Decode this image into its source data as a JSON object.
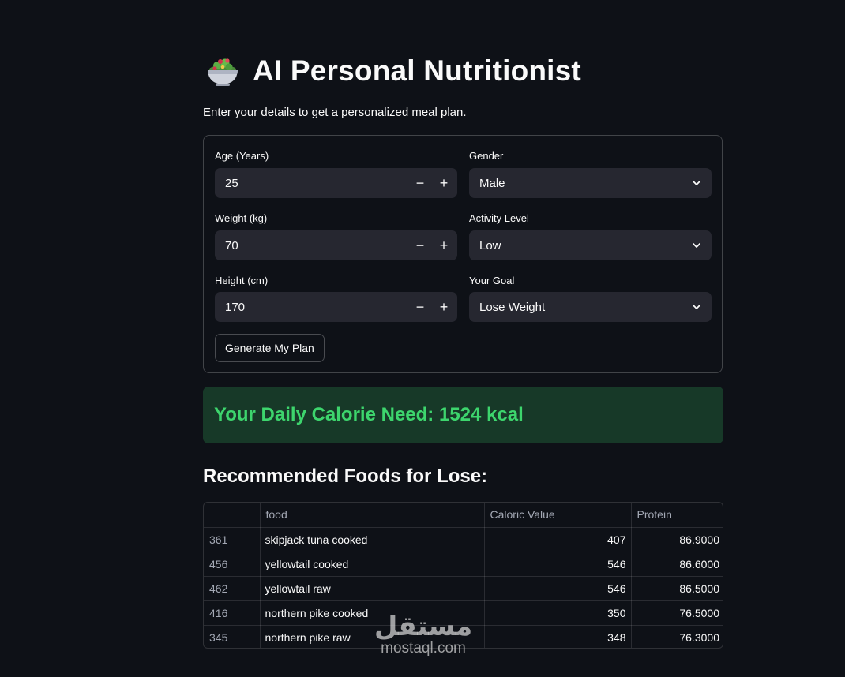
{
  "header": {
    "icon": "salad-bowl-icon",
    "title": "AI Personal Nutritionist",
    "subtitle": "Enter your details to get a personalized meal plan."
  },
  "form": {
    "age": {
      "label": "Age (Years)",
      "value": "25"
    },
    "weight": {
      "label": "Weight (kg)",
      "value": "70"
    },
    "height": {
      "label": "Height (cm)",
      "value": "170"
    },
    "gender": {
      "label": "Gender",
      "value": "Male"
    },
    "activity": {
      "label": "Activity Level",
      "value": "Low"
    },
    "goal": {
      "label": "Your Goal",
      "value": "Lose Weight"
    },
    "minus": "−",
    "plus": "+",
    "generate_label": "Generate My Plan"
  },
  "result": {
    "message": "Your Daily Calorie Need: 1524 kcal"
  },
  "recommendations": {
    "heading": "Recommended Foods for Lose:",
    "columns": [
      "",
      "food",
      "Caloric Value",
      "Protein"
    ],
    "rows": [
      {
        "index": "361",
        "food": "skipjack tuna cooked",
        "calories": "407",
        "protein": "86.9000"
      },
      {
        "index": "456",
        "food": "yellowtail cooked",
        "calories": "546",
        "protein": "86.6000"
      },
      {
        "index": "462",
        "food": "yellowtail raw",
        "calories": "546",
        "protein": "86.5000"
      },
      {
        "index": "416",
        "food": "northern pike cooked",
        "calories": "350",
        "protein": "76.5000"
      },
      {
        "index": "345",
        "food": "northern pike raw",
        "calories": "348",
        "protein": "76.3000"
      }
    ]
  },
  "watermark": {
    "arabic": "مستقل",
    "latin": "mostaql.com"
  },
  "colors": {
    "background": "#0e1117",
    "input_bg": "#262730",
    "success_bg": "#173928",
    "success_text": "#3dd56d"
  }
}
